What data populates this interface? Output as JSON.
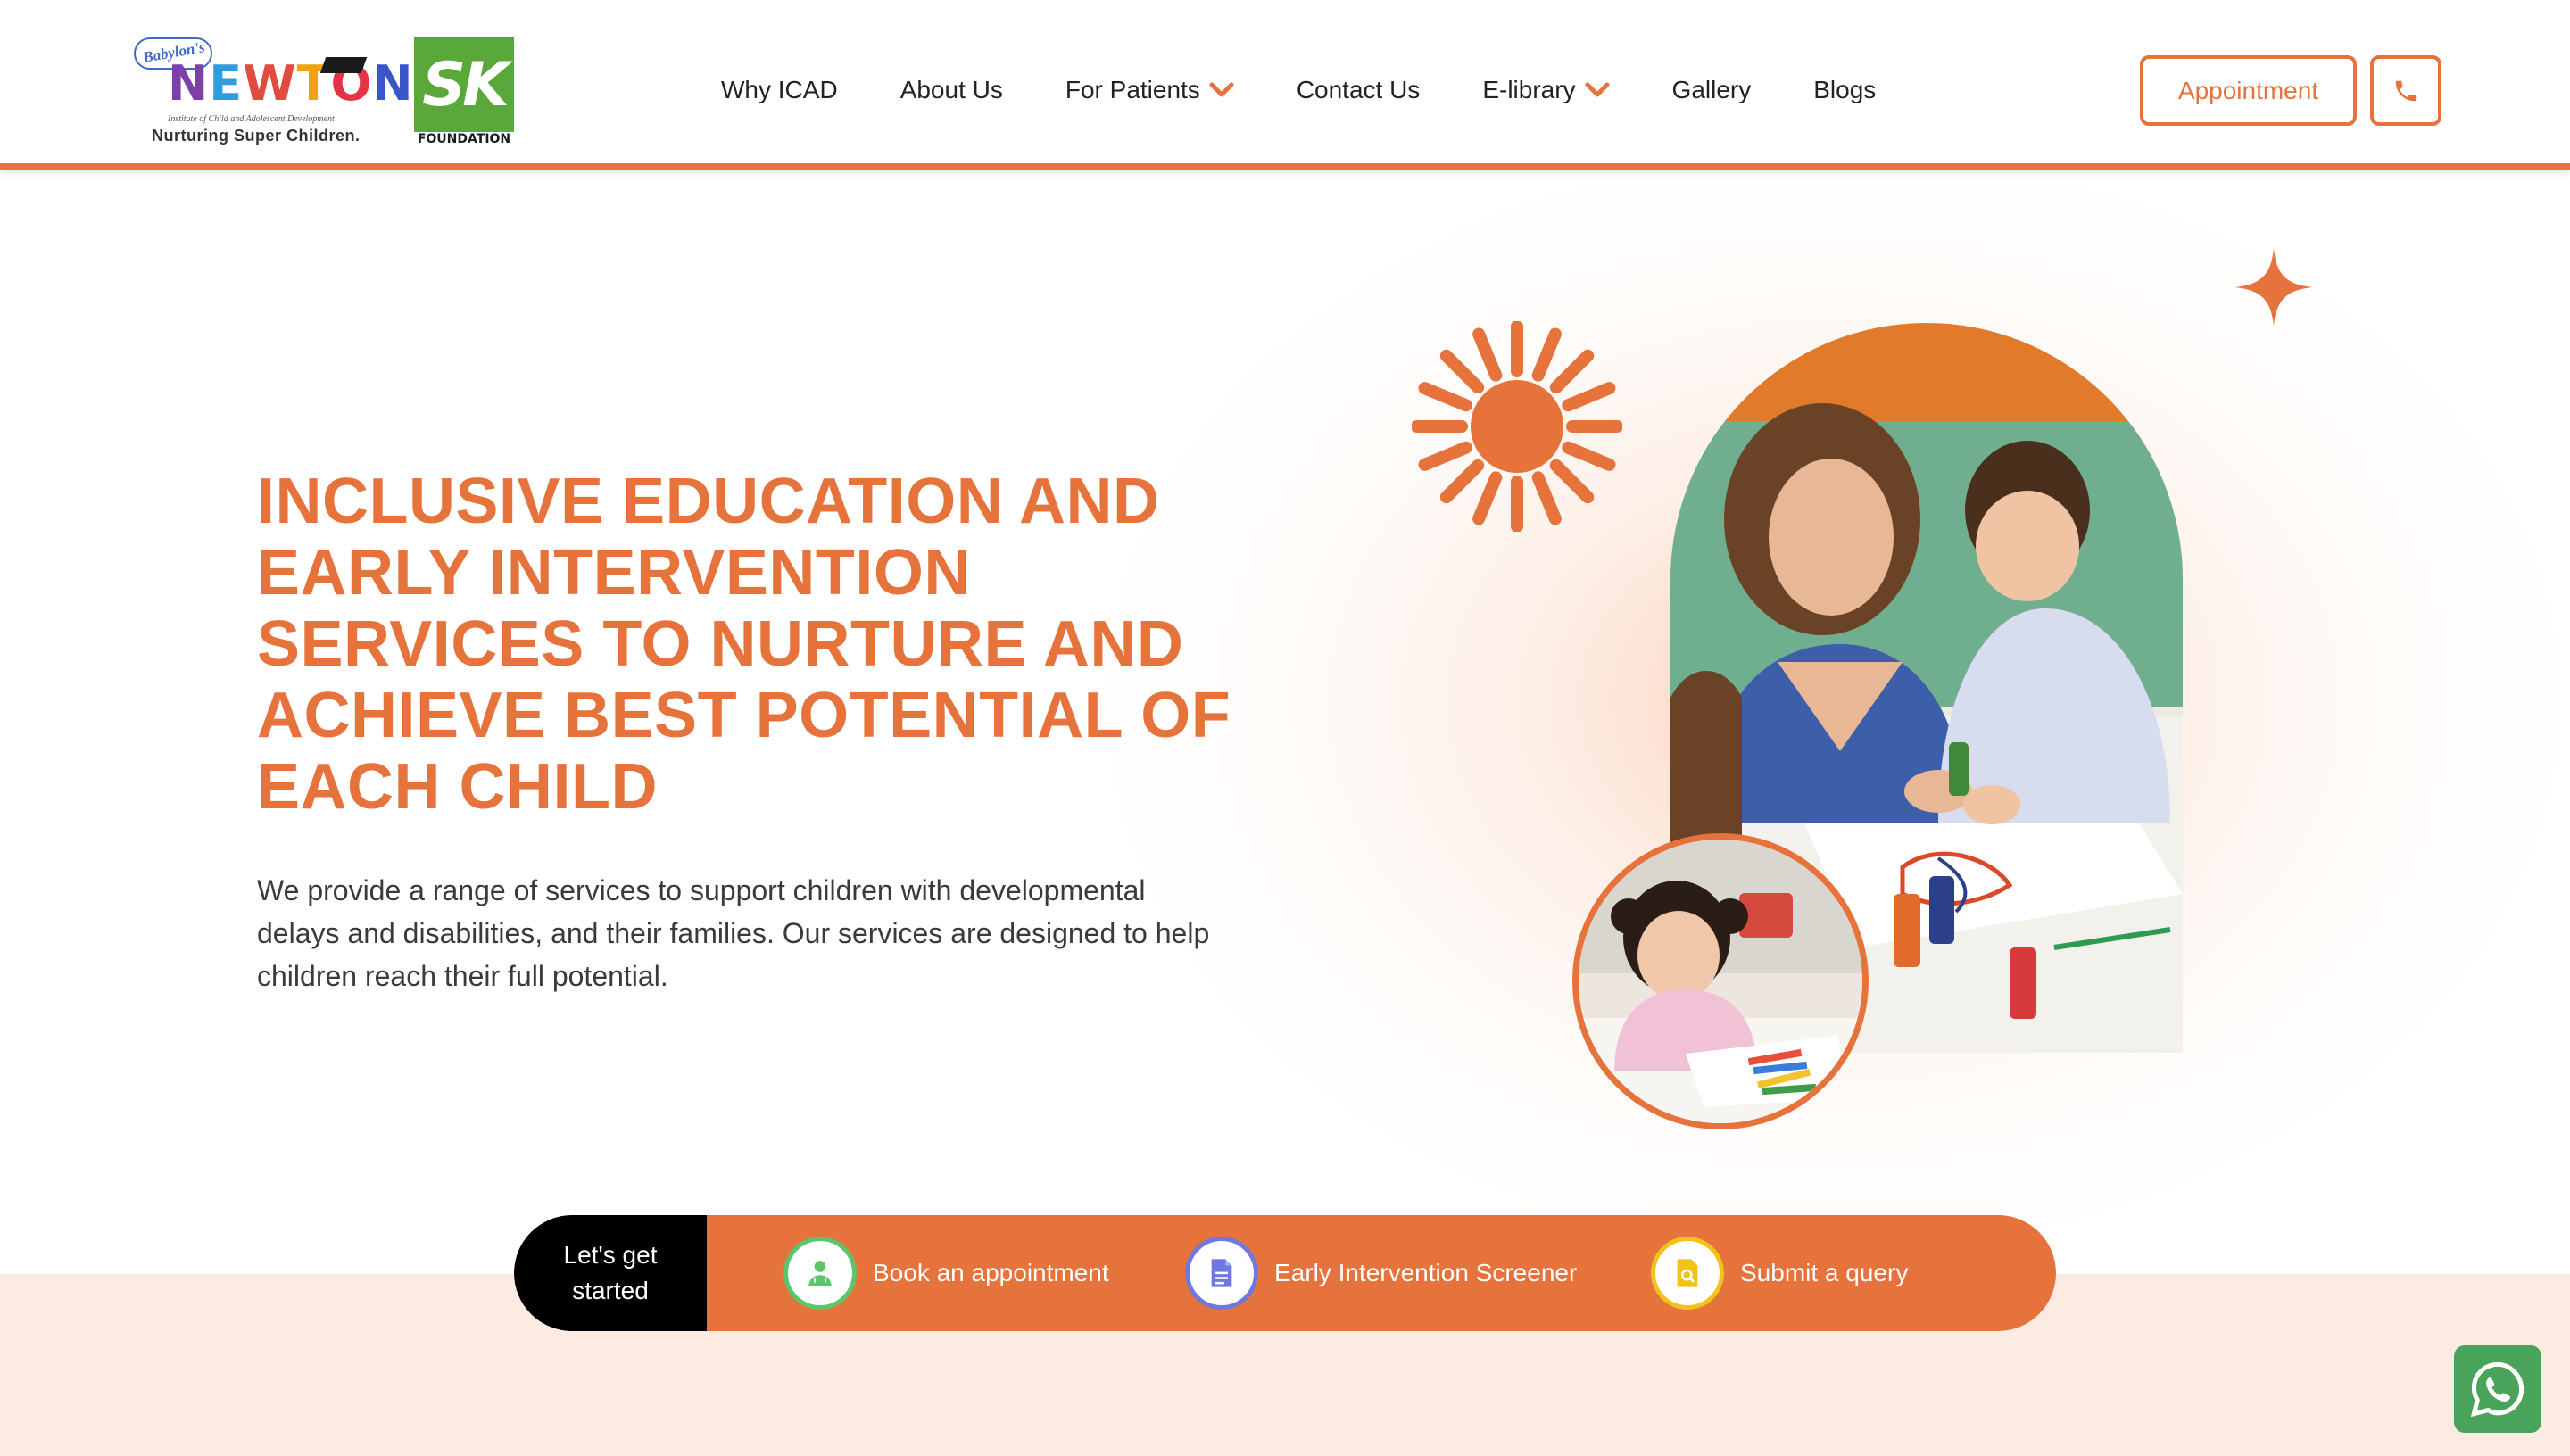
{
  "brand": {
    "newton_tag": "Babylon's",
    "newton_name": [
      "N",
      "E",
      "W",
      "T",
      "O",
      "N"
    ],
    "newton_subtitle": "Institute of Child and Adolescent Development",
    "newton_slogan": "Nurturing Super Children.",
    "sk_mark": "SK",
    "sk_caption": "FOUNDATION"
  },
  "nav": {
    "items": [
      {
        "label": "Why ICAD",
        "has_dropdown": false
      },
      {
        "label": "About Us",
        "has_dropdown": false
      },
      {
        "label": "For Patients",
        "has_dropdown": true
      },
      {
        "label": "Contact Us",
        "has_dropdown": false
      },
      {
        "label": "E-library",
        "has_dropdown": true
      },
      {
        "label": "Gallery",
        "has_dropdown": false
      },
      {
        "label": "Blogs",
        "has_dropdown": false
      }
    ],
    "appointment_label": "Appointment",
    "phone_icon": "phone-icon"
  },
  "hero": {
    "title": "INCLUSIVE EDUCATION AND EARLY INTERVENTION SERVICES TO NURTURE AND ACHIEVE BEST POTENTIAL OF EACH CHILD",
    "description": "We provide a range of services to support children with developmental delays and disabilities, and their families. Our services are designed to help children reach their full potential."
  },
  "cta": {
    "start_label": "Let's get started",
    "items": [
      {
        "label": "Book an appointment",
        "icon": "doctor-icon",
        "ring_color": "#5cc46a"
      },
      {
        "label": "Early Intervention Screener",
        "icon": "document-icon",
        "ring_color": "#6f78e0"
      },
      {
        "label": "Submit a query",
        "icon": "search-document-icon",
        "ring_color": "#f2c21b"
      }
    ]
  },
  "colors": {
    "accent": "#E5733B",
    "band": "#FBEBE2",
    "whatsapp": "#4aa35b"
  }
}
